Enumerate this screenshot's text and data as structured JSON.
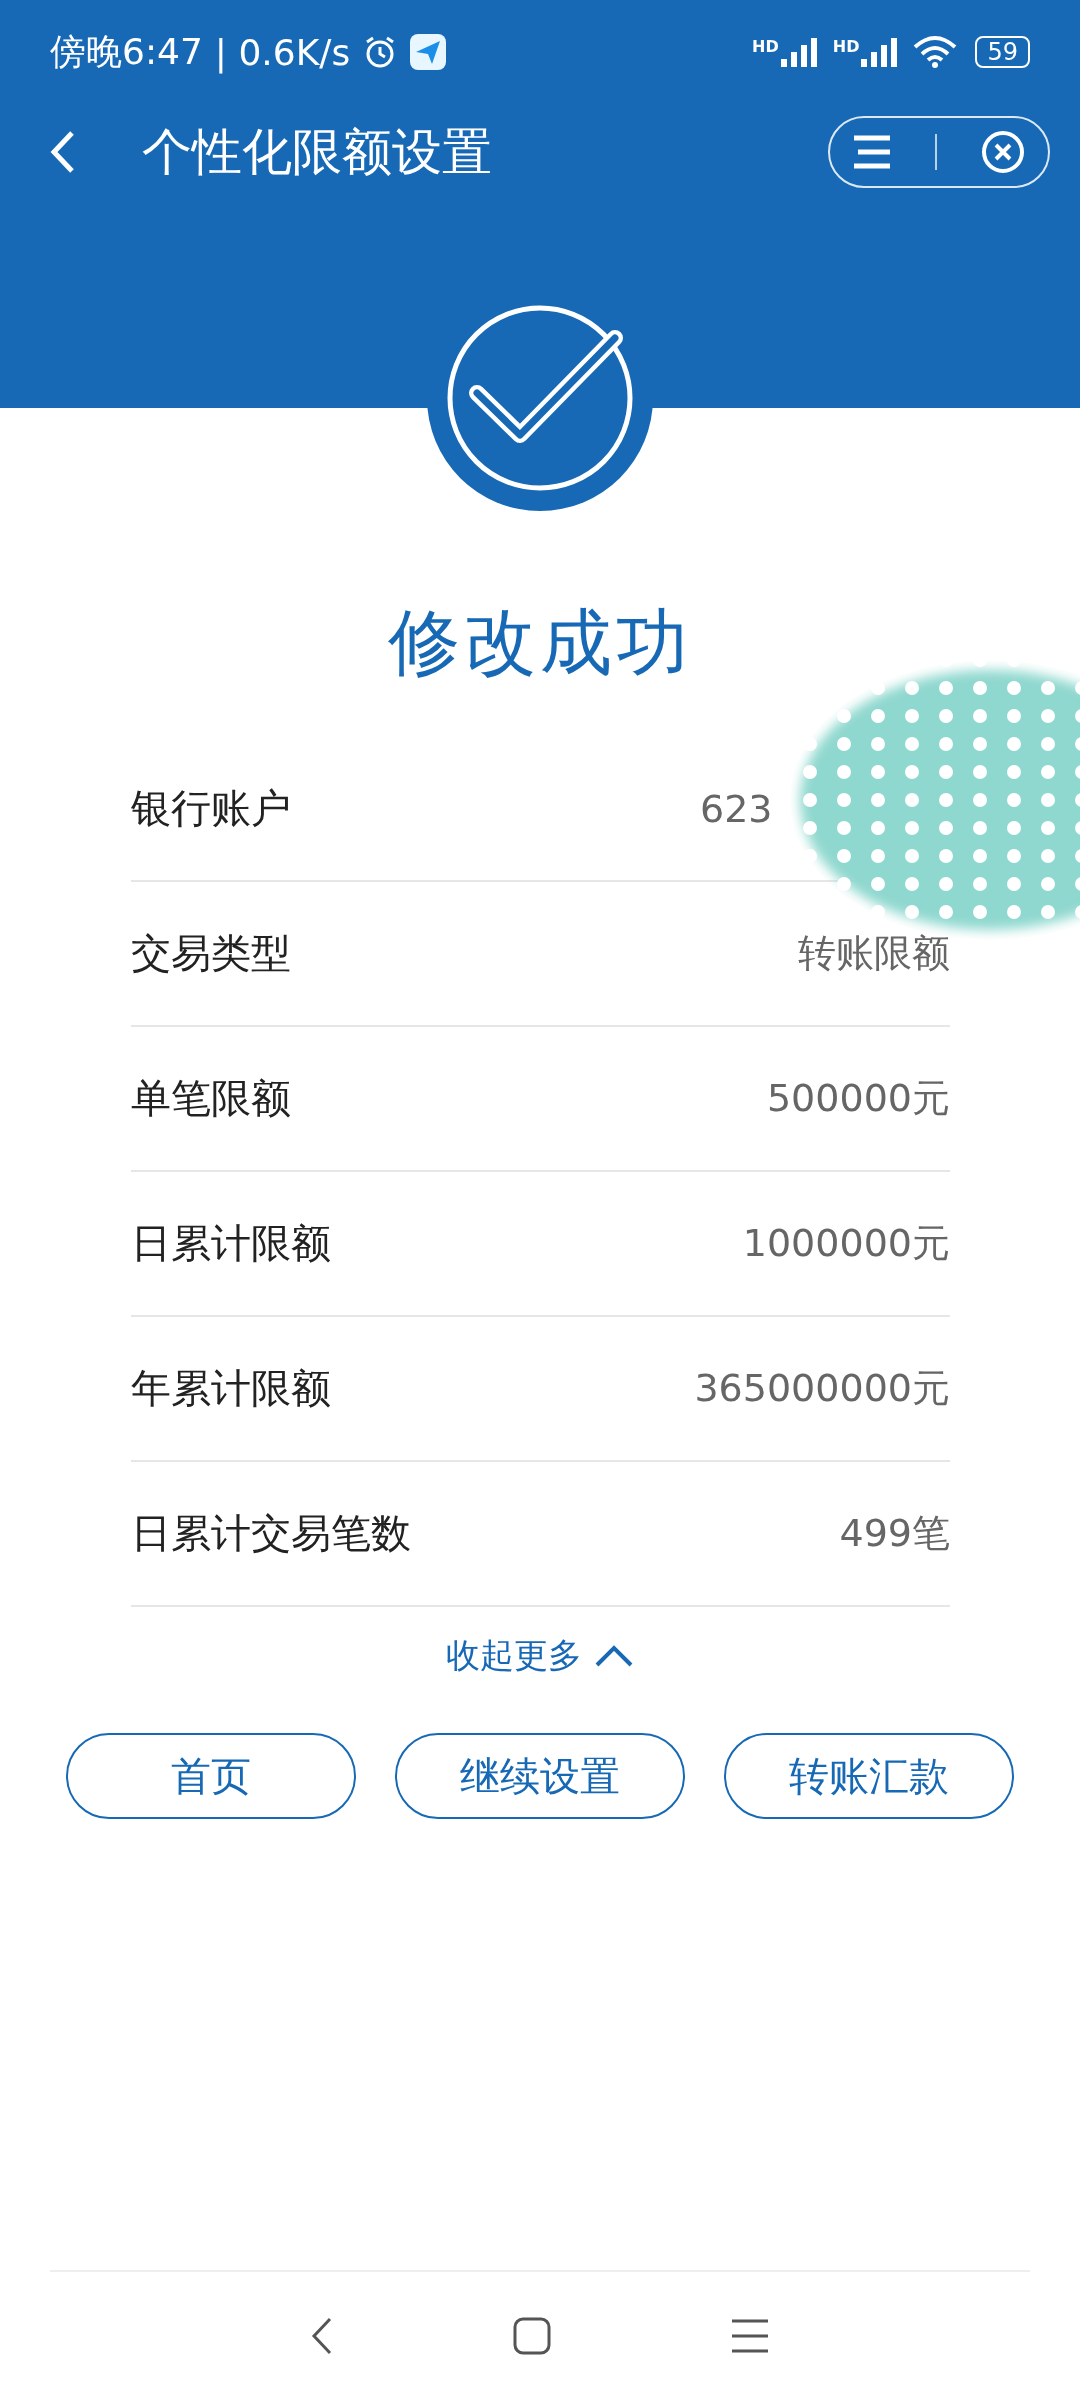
{
  "status_bar": {
    "time": "傍晚6:47",
    "speed": "| 0.6K/s",
    "battery": "59",
    "network_badges": [
      "HD",
      "HD"
    ]
  },
  "header": {
    "title": "个性化限额设置"
  },
  "result": {
    "title": "修改成功"
  },
  "details": [
    {
      "label": "银行账户",
      "value": "623"
    },
    {
      "label": "交易类型",
      "value": "转账限额"
    },
    {
      "label": "单笔限额",
      "value": "500000元"
    },
    {
      "label": "日累计限额",
      "value": "1000000元"
    },
    {
      "label": "年累计限额",
      "value": "365000000元"
    },
    {
      "label": "日累计交易笔数",
      "value": "499笔"
    }
  ],
  "collapse_link": {
    "label": "收起更多",
    "expanded": true
  },
  "buttons": [
    "首页",
    "继续设置",
    "转账汇款"
  ]
}
